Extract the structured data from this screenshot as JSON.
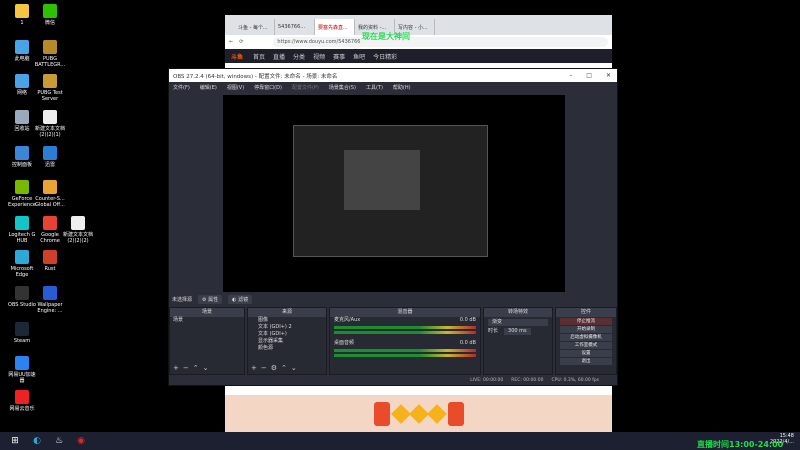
{
  "desktop": {
    "icons": [
      {
        "label": "1",
        "color": "#f5c542"
      },
      {
        "label": "微信",
        "color": "#2dc100"
      },
      {
        "label": "此电脑",
        "color": "#4aa3e6"
      },
      {
        "label": "PUBG\nBATTLEGR...",
        "color": "#b58a2b"
      },
      {
        "label": "网络",
        "color": "#4aa3e6"
      },
      {
        "label": "PUBG Test\nServer",
        "color": "#c99a36"
      },
      {
        "label": "回收站",
        "color": "#9ab"
      },
      {
        "label": "新建文本文档\n(2)(2)(1)",
        "color": "#eee"
      },
      {
        "label": "控制面板",
        "color": "#3b86d8"
      },
      {
        "label": "迅雷",
        "color": "#2a7fd4"
      },
      {
        "label": "GeForce\nExperience",
        "color": "#76b900"
      },
      {
        "label": "Counter-S...\nGlobal Off...",
        "color": "#e9a234"
      },
      {
        "label": "Logitech G\nHUB",
        "color": "#11c5c9"
      },
      {
        "label": "Google\nChrome",
        "color": "#e94235"
      },
      {
        "label": "新建文本文档\n(2)(2)(2)",
        "color": "#eee"
      },
      {
        "label": "Microsoft\nEdge",
        "color": "#2ea7d9"
      },
      {
        "label": "Rust",
        "color": "#cd412b"
      },
      {
        "label": "OBS Studio",
        "color": "#333"
      },
      {
        "label": "Wallpaper\nEngine: ...",
        "color": "#2a5bd7"
      },
      {
        "label": "Steam",
        "color": "#1b2838"
      },
      {
        "label": "网易UU加速\n器",
        "color": "#2b82f0"
      },
      {
        "label": "网易云音乐",
        "color": "#e22"
      }
    ]
  },
  "browser": {
    "tabs": [
      "斗鱼 - 每个...",
      "5436766...",
      "要塞先森直...",
      "我的资料 -...",
      "写内容 - 小..."
    ],
    "url": "https://www.douyu.com/5436766",
    "logo": "斗鱼",
    "nav": [
      "首页",
      "直播",
      "分类",
      "视频",
      "赛事",
      "鱼吧",
      "今日精彩"
    ],
    "overlay_text": "现在是大神间"
  },
  "obs": {
    "title": "OBS 27.2.4 (64-bit, windows) - 配置文件: 未命名 - 场景: 未命名",
    "menu": [
      "文件(F)",
      "编辑(E)",
      "视图(V)",
      "停靠窗口(D)",
      "配置文件(P)",
      "场景集合(S)",
      "工具(T)",
      "帮助(H)"
    ],
    "no_source": "未选择源",
    "props_btn": "属性",
    "filter_btn": "滤镜",
    "docks": {
      "scenes": {
        "title": "场景",
        "items": [
          "场景"
        ]
      },
      "sources": {
        "title": "来源",
        "items": [
          "图像",
          "文本 (GDI+) 2",
          "文本 (GDI+)",
          "显示器采集",
          "颜色源"
        ]
      },
      "mixer": {
        "title": "混音器",
        "tracks": [
          {
            "name": "麦克风/Aux",
            "db": "0.0 dB"
          },
          {
            "name": "桌面音频",
            "db": "0.0 dB"
          }
        ]
      },
      "transitions": {
        "title": "转场特效",
        "type": "渐变",
        "duration_label": "时长",
        "duration": "300 ms"
      },
      "controls": {
        "title": "控件",
        "buttons": [
          "停止推流",
          "开始录制",
          "启动虚拟摄像机",
          "工作室模式",
          "设置",
          "退出"
        ]
      }
    },
    "status": [
      "LIVE: 00:00:00",
      "REC: 00:00:00",
      "CPU: 0.3%, 60.00 fps"
    ]
  },
  "taskbar": {
    "time": "15:48",
    "date": "2022/4/..."
  },
  "live_time": "直播时间13:00-24:00"
}
